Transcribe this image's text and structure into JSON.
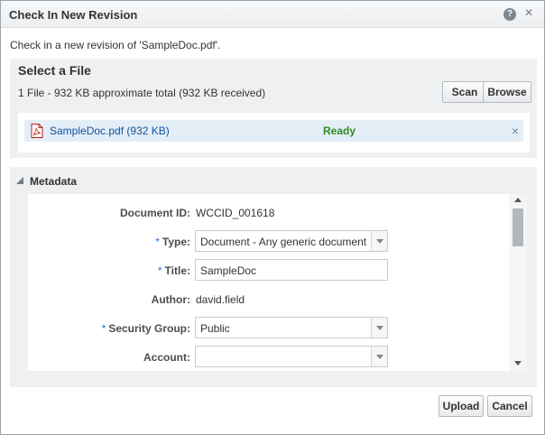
{
  "dialog": {
    "title": "Check In New Revision",
    "help_icon": "?",
    "close_icon": "×",
    "intro": "Check in a new revision of 'SampleDoc.pdf'."
  },
  "select_file": {
    "title": "Select a File",
    "summary": "1 File  -  932 KB  approximate total    (932 KB received)",
    "scan_label": "Scan",
    "browse_label": "Browse",
    "file": {
      "name": "SampleDoc.pdf (932 KB)",
      "status": "Ready",
      "remove_icon": "×",
      "status_color": "#2e8a1e"
    }
  },
  "metadata": {
    "title": "Metadata",
    "fields": {
      "document_id": {
        "label": "Document ID:",
        "value": "WCCID_001618"
      },
      "type": {
        "required": "*",
        "label": "Type:",
        "value": "Document - Any generic document"
      },
      "title": {
        "required": "*",
        "label": "Title:",
        "value": "SampleDoc"
      },
      "author": {
        "label": "Author:",
        "value": "david.field"
      },
      "security_group": {
        "required": "*",
        "label": "Security Group:",
        "value": "Public"
      },
      "account": {
        "label": "Account:",
        "value": ""
      }
    }
  },
  "footer": {
    "upload_label": "Upload",
    "cancel_label": "Cancel"
  },
  "colors": {
    "link": "#14509e",
    "required": "#2a6fd8",
    "panel_bg": "#eef0f2"
  }
}
